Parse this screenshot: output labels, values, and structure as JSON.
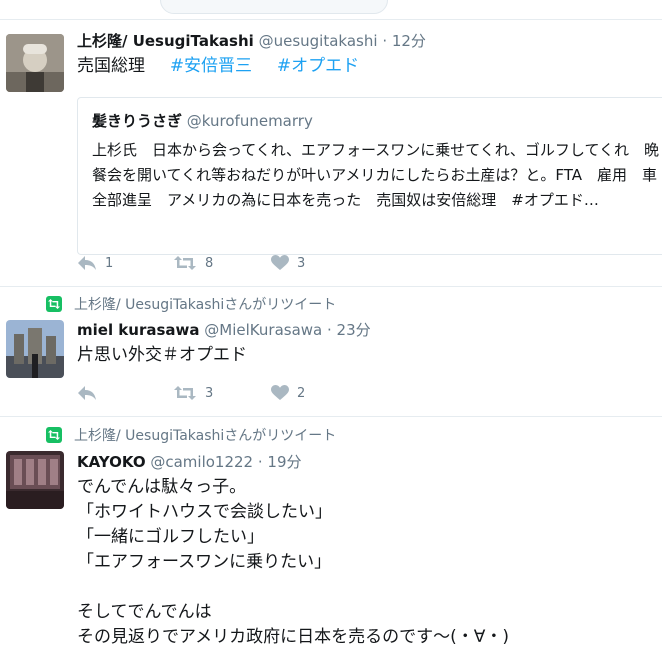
{
  "tweets": [
    {
      "name": "上杉隆/ UesugiTakashi",
      "handle": "@uesugitakashi",
      "time": "· 12分",
      "body_text": "売国総理",
      "hashtags": [
        "#安倍晋三",
        "#オプエド"
      ],
      "quote": {
        "name": "髪きりうさぎ",
        "handle": "@kurofunemarry",
        "text": "上杉氏　日本から会ってくれ、エアフォースワンに乗せてくれ、ゴルフしてくれ　晩餐会を開いてくれ等おねだりが叶いアメリカにしたらお土産は？と。FTA　雇用　車全部進呈　アメリカの為に日本を売った　売国奴は安倍総理　#オプエド…"
      },
      "reply_count": "1",
      "retweet_count": "8",
      "like_count": "3"
    },
    {
      "retweet_context": "上杉隆/ UesugiTakashiさんがリツイート",
      "name": "miel kurasawa",
      "handle": "@MielKurasawa",
      "time": "· 23分",
      "body_text": "片思い外交＃オプエド",
      "reply_count": "",
      "retweet_count": "3",
      "like_count": "2"
    },
    {
      "retweet_context": "上杉隆/ UesugiTakashiさんがリツイート",
      "name": "KAYOKO",
      "handle": "@camilo1222",
      "time": "· 19分",
      "lines": [
        "でんでんは駄々っ子。",
        "「ホワイトハウスで会談したい」",
        "「一緒にゴルフしたい」",
        "「エアフォースワンに乗りたい」",
        "",
        "そしてでんでんは",
        "その見返りでアメリカ政府に日本を売るのです〜(・∀・)"
      ]
    }
  ],
  "colors": {
    "accent": "#1da1f2",
    "muted": "#657786",
    "icon": "#aab8c2",
    "retweet_green": "#17bf63"
  },
  "icons": [
    "reply-icon",
    "retweet-icon",
    "heart-icon",
    "retweet-context-icon"
  ]
}
